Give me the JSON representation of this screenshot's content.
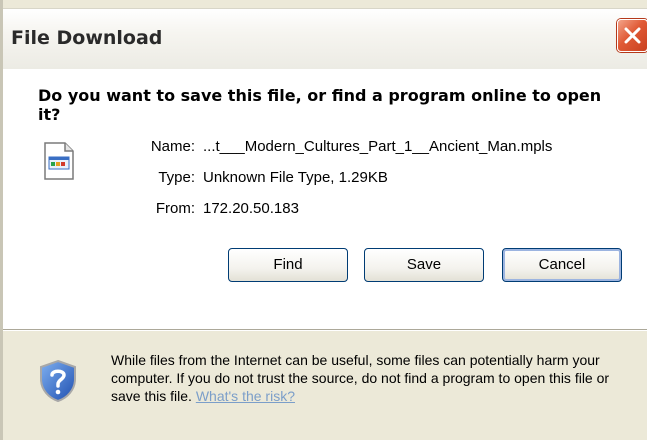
{
  "dialog": {
    "title": "File Download",
    "question": "Do you want to save this file, or find a program online to open it?",
    "file_info": {
      "name_label": "Name:",
      "name_value": "...t___Modern_Cultures_Part_1__Ancient_Man.mpls",
      "type_label": "Type:",
      "type_value": "Unknown File Type, 1.29KB",
      "from_label": "From:",
      "from_value": "172.20.50.183"
    },
    "buttons": {
      "find": "Find",
      "save": "Save",
      "cancel": "Cancel"
    },
    "warning_text": "While files from the Internet can be useful, some files can potentially harm your computer. If you do not trust the source, do not find a program to open this file or save this file.",
    "risk_link": "What's the risk?"
  },
  "icons": {
    "close": "close-icon",
    "file": "file-icon",
    "shield": "shield-help-icon"
  },
  "colors": {
    "window_bg": "#ece9d8",
    "close_button": "#e05a36",
    "button_border": "#003c74",
    "link": "#7b9ec9"
  }
}
